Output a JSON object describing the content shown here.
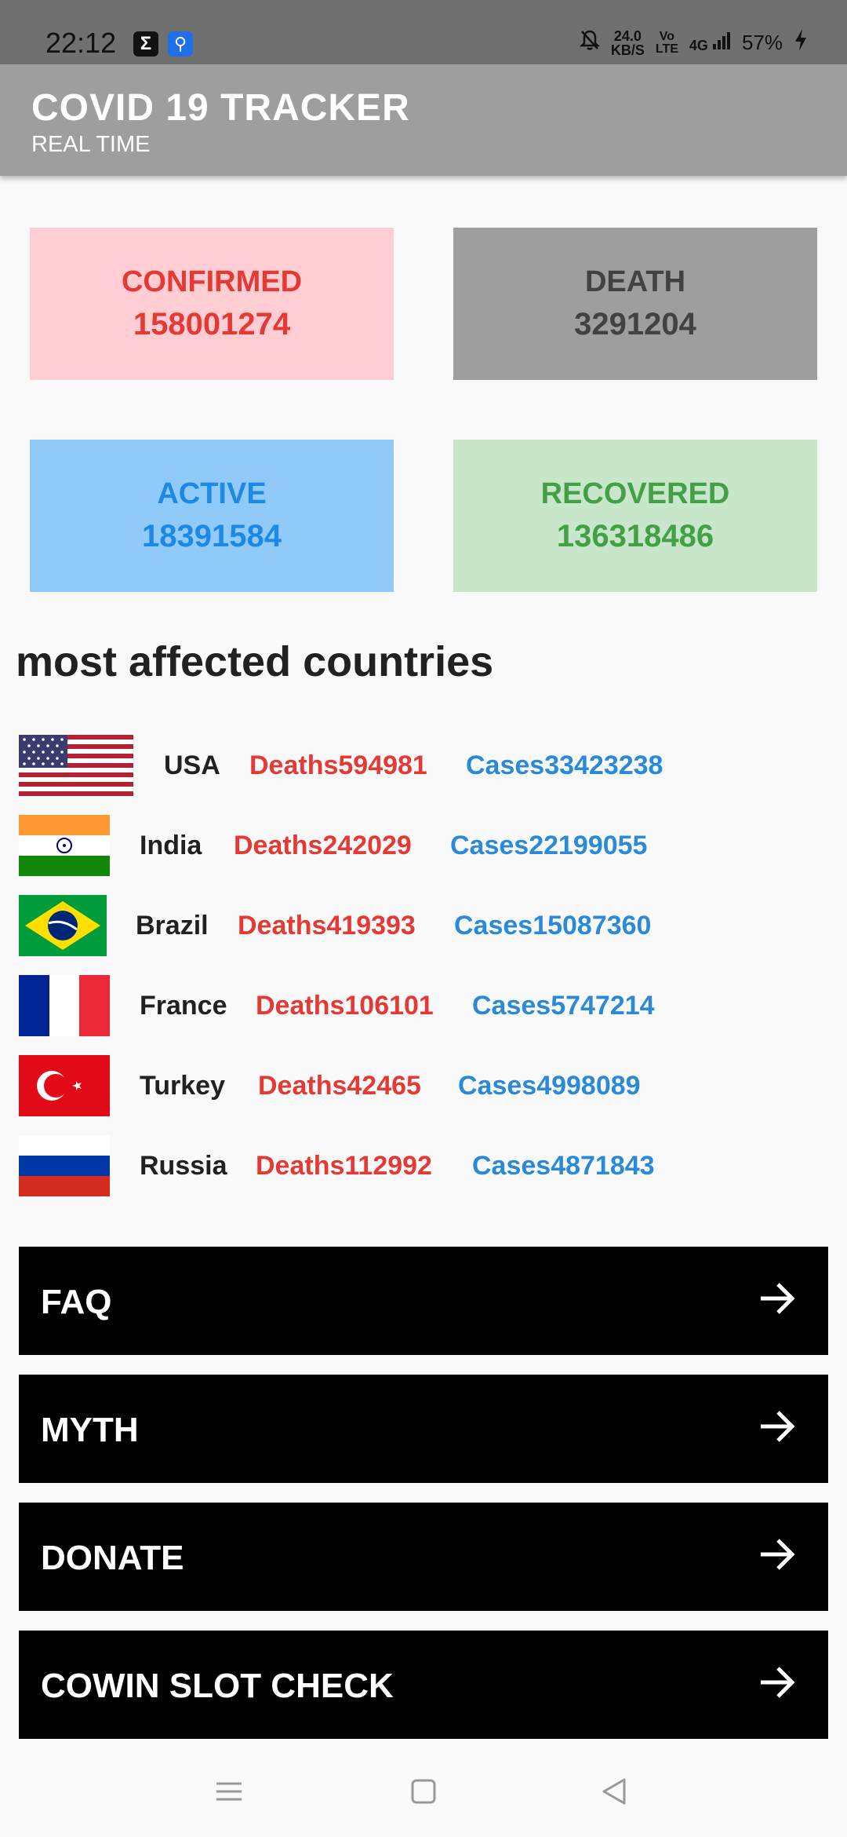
{
  "status_bar": {
    "time": "22:12",
    "speed_value": "24.0",
    "speed_unit": "KB/S",
    "volte_top": "Vo",
    "volte_bottom": "LTE",
    "network": "4G",
    "battery": "57%",
    "icons": [
      "sigma-app-icon",
      "usb-icon",
      "bell-off-icon",
      "signal-icon",
      "charging-icon"
    ]
  },
  "app_bar": {
    "title": "COVID 19 TRACKER",
    "subtitle": "REAL TIME"
  },
  "stats": {
    "confirmed": {
      "label": "CONFIRMED",
      "value": "158001274",
      "bg": "#ffcdd2",
      "color": "#e53935"
    },
    "death": {
      "label": "DEATH",
      "value": "3291204",
      "bg": "#9e9e9e",
      "color": "#424242"
    },
    "active": {
      "label": "ACTIVE",
      "value": "18391584",
      "bg": "#90caf9",
      "color": "#1e88e5"
    },
    "recovered": {
      "label": "RECOVERED",
      "value": "136318486",
      "bg": "#c8e6c9",
      "color": "#43a047"
    }
  },
  "section_title": "most affected countries",
  "countries": [
    {
      "name": "USA",
      "deaths": "Deaths594981",
      "cases": "Cases33423238",
      "flag": "usa-flag-icon"
    },
    {
      "name": "India",
      "deaths": "Deaths242029",
      "cases": "Cases22199055",
      "flag": "india-flag-icon"
    },
    {
      "name": "Brazil",
      "deaths": "Deaths419393",
      "cases": "Cases15087360",
      "flag": "brazil-flag-icon"
    },
    {
      "name": "France",
      "deaths": "Deaths106101",
      "cases": "Cases5747214",
      "flag": "france-flag-icon"
    },
    {
      "name": "Turkey",
      "deaths": "Deaths42465",
      "cases": "Cases4998089",
      "flag": "turkey-flag-icon"
    },
    {
      "name": "Russia",
      "deaths": "Deaths112992",
      "cases": "Cases4871843",
      "flag": "russia-flag-icon"
    }
  ],
  "nav_buttons": [
    {
      "label": "FAQ",
      "icon": "arrow-right-icon"
    },
    {
      "label": "MYTH",
      "icon": "arrow-right-icon"
    },
    {
      "label": "DONATE",
      "icon": "arrow-right-icon"
    },
    {
      "label": "COWIN SLOT CHECK",
      "icon": "arrow-right-icon"
    }
  ],
  "system_nav": [
    "menu-icon",
    "home-icon",
    "back-icon"
  ]
}
